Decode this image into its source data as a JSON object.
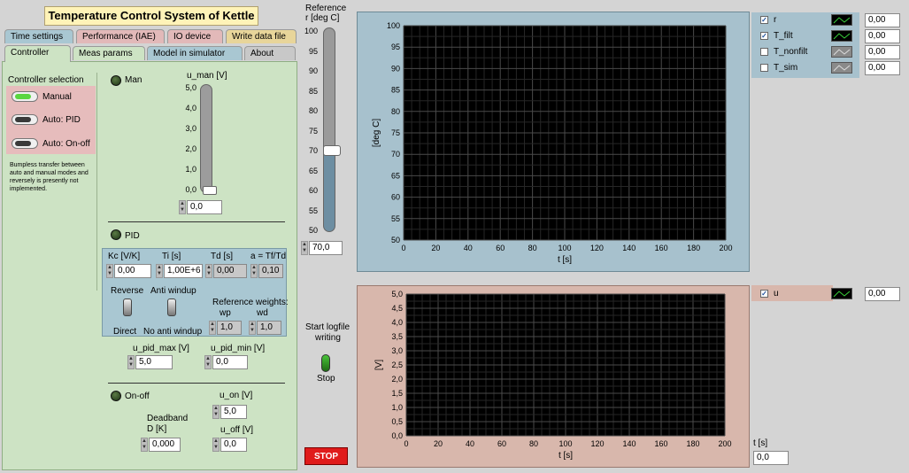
{
  "app": {
    "title": "Temperature Control System of Kettle"
  },
  "tabs_row1": [
    "Time settings",
    "Performance (IAE)",
    "IO device",
    "Write data file"
  ],
  "tabs_row2": [
    "Controller",
    "Meas params",
    "Model in simulator",
    "About"
  ],
  "controller_selection": {
    "header": "Controller selection",
    "options": [
      "Manual",
      "Auto: PID",
      "Auto: On-off"
    ],
    "note": "Bumpless transfer between auto and manual modes and reversely is presently not implemented."
  },
  "manual": {
    "label": "Man",
    "slider_label": "u_man [V]",
    "ticks": [
      "5,0",
      "4,0",
      "3,0",
      "2,0",
      "1,0",
      "0,0"
    ],
    "value": "0,0",
    "level_fraction": 0
  },
  "pid": {
    "label": "PID",
    "kc_label": "Kc [V/K]",
    "kc_value": "0,00",
    "ti_label": "Ti [s]",
    "ti_value": "1,00E+6",
    "td_label": "Td [s]",
    "td_value": "0,00",
    "a_label": "a = Tf/Td",
    "a_value": "0,10",
    "reverse_label": "Reverse",
    "direct_label": "Direct",
    "antiwindup_label": "Anti windup",
    "no_antiwindup_label": "No anti windup",
    "ref_weights_label": "Reference weights:",
    "wp_label": "wp",
    "wp_value": "1,0",
    "wd_label": "wd",
    "wd_value": "1,0",
    "umax_label": "u_pid_max [V]",
    "umax_value": "5,0",
    "umin_label": "u_pid_min [V]",
    "umin_value": "0,0"
  },
  "onoff": {
    "label": "On-off",
    "uon_label": "u_on [V]",
    "uon_value": "5,0",
    "deadband_label_1": "Deadband",
    "deadband_label_2": "D [K]",
    "deadband_value": "0,000",
    "uoff_label": "u_off [V]",
    "uoff_value": "0,0"
  },
  "reference": {
    "label_1": "Reference",
    "label_2": "r [deg C]",
    "ticks": [
      "100",
      "95",
      "90",
      "85",
      "80",
      "75",
      "70",
      "65",
      "60",
      "55",
      "50"
    ],
    "value": "70,0",
    "level_fraction": 0.4
  },
  "logfile": {
    "label_1": "Start logfile",
    "label_2": "writing",
    "state_label": "Stop"
  },
  "stop_button": {
    "label": "STOP"
  },
  "plot_top": {
    "ylabel": "[deg C]",
    "xlabel": "t [s]",
    "yticks": [
      "100",
      "95",
      "90",
      "85",
      "80",
      "75",
      "70",
      "65",
      "60",
      "55",
      "50"
    ],
    "xticks": [
      "0",
      "20",
      "40",
      "60",
      "80",
      "100",
      "120",
      "140",
      "160",
      "180",
      "200"
    ],
    "legend": [
      {
        "name": "r",
        "checked": true,
        "value": "0,00"
      },
      {
        "name": "T_filt",
        "checked": true,
        "value": "0,00"
      },
      {
        "name": "T_nonfilt",
        "checked": false,
        "value": "0,00"
      },
      {
        "name": "T_sim",
        "checked": false,
        "value": "0,00"
      }
    ]
  },
  "plot_bottom": {
    "ylabel": "[V]",
    "xlabel": "t [s]",
    "yticks": [
      "5,0",
      "4,5",
      "4,0",
      "3,5",
      "3,0",
      "2,5",
      "2,0",
      "1,5",
      "1,0",
      "0,5",
      "0,0"
    ],
    "xticks": [
      "0",
      "20",
      "40",
      "60",
      "80",
      "100",
      "120",
      "140",
      "160",
      "180",
      "200"
    ],
    "legend": [
      {
        "name": "u",
        "checked": true,
        "value": "0,00"
      }
    ]
  },
  "time_readout": {
    "label": "t [s]",
    "value": "0,0"
  },
  "colors": {
    "plot_bg": "#000000",
    "grid": "#3c3c3c",
    "green_panel": "#cde3c4",
    "stop_red": "#e01b1b"
  }
}
